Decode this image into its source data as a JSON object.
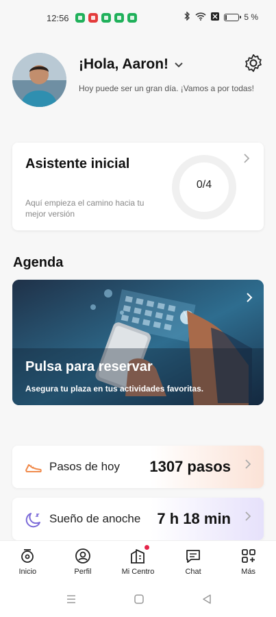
{
  "status_bar": {
    "time": "12:56",
    "battery": "5 %"
  },
  "header": {
    "greeting": "¡Hola, Aaron!",
    "subtitle": "Hoy puede ser un gran día. ¡Vamos a por todas!"
  },
  "assistant_card": {
    "title": "Asistente inicial",
    "subtitle": "Aquí empieza el camino hacia tu mejor versión",
    "progress": "0/4",
    "progress_fraction": 0
  },
  "agenda": {
    "title": "Agenda",
    "banner_title": "Pulsa para reservar",
    "banner_subtitle": "Asegura tu plaza en tus actividades favoritas."
  },
  "metrics": [
    {
      "label": "Pasos de hoy",
      "value": "1307 pasos",
      "icon": "shoe-icon"
    },
    {
      "label": "Sueño de anoche",
      "value": "7 h 18 min",
      "icon": "moon-icon"
    }
  ],
  "bottom_nav": [
    {
      "label": "Inicio",
      "icon": "home-icon"
    },
    {
      "label": "Perfil",
      "icon": "profile-icon"
    },
    {
      "label": "Mi Centro",
      "icon": "building-icon",
      "badge": true
    },
    {
      "label": "Chat",
      "icon": "chat-icon"
    },
    {
      "label": "Más",
      "icon": "grid-plus-icon"
    }
  ],
  "colors": {
    "steps_gradient": "#fbe2d6",
    "sleep_gradient": "#e6e1fb",
    "steps_icon": "#f08a4b",
    "sleep_icon": "#7b6ad8",
    "badge": "#e5254a"
  }
}
